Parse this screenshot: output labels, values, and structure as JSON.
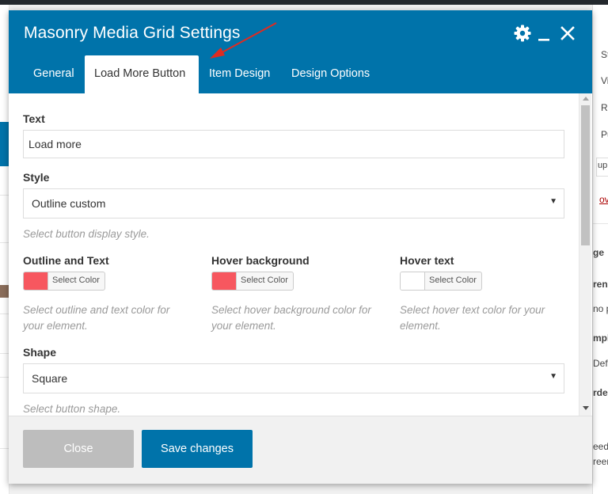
{
  "modal": {
    "title": "Masonry Media Grid Settings",
    "tabs": [
      {
        "label": "General",
        "active": false
      },
      {
        "label": "Load More Button",
        "active": true
      },
      {
        "label": "Item Design",
        "active": false
      },
      {
        "label": "Design Options",
        "active": false
      }
    ],
    "header_icons": [
      "gear-icon",
      "minimize-icon",
      "close-icon"
    ],
    "accent_color": "#0073aa"
  },
  "fields": {
    "text": {
      "label": "Text",
      "value": "Load more"
    },
    "style": {
      "label": "Style",
      "selected": "Outline custom",
      "help": "Select button display style."
    },
    "outline_and_text": {
      "label": "Outline and Text",
      "button_label": "Select Color",
      "color": "#f7575f",
      "help": "Select outline and text color for your element."
    },
    "hover_background": {
      "label": "Hover background",
      "button_label": "Select Color",
      "color": "#f7575f",
      "help": "Select hover background color for your element."
    },
    "hover_text": {
      "label": "Hover text",
      "button_label": "Select Color",
      "color": "#ffffff",
      "help": "Select hover text color for your element."
    },
    "shape": {
      "label": "Shape",
      "selected": "Square",
      "help": "Select button shape."
    }
  },
  "footer": {
    "close_label": "Close",
    "save_label": "Save changes"
  },
  "background": {
    "right_panel_text": [
      "St",
      "Vi",
      "Re",
      "Pu",
      "uplic",
      "ove",
      "ge",
      "ren",
      "no p",
      "mpl",
      "Defa",
      "rder",
      "eed",
      "reen"
    ]
  }
}
